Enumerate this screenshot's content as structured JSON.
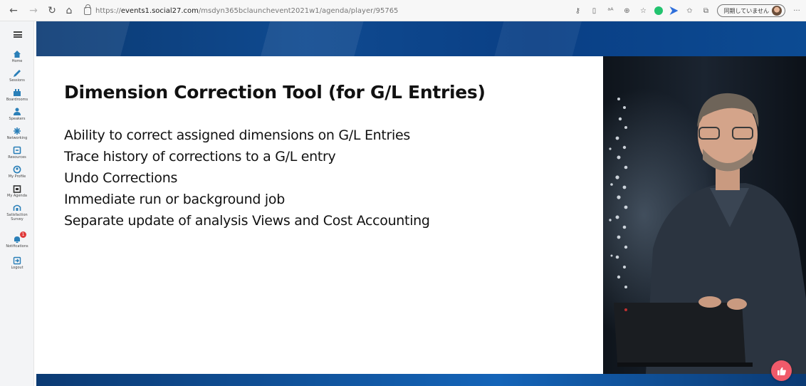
{
  "browser": {
    "url_prefix": "https://",
    "url_host": "events1.social27.com",
    "url_path": "/msdyn365bclaunchevent2021w1/agenda/player/95765",
    "sync_label": "同期していません"
  },
  "sidebar": {
    "items": [
      {
        "label": "Home",
        "icon": "home-icon"
      },
      {
        "label": "Sessions",
        "icon": "pencil-icon"
      },
      {
        "label": "Boardrooms",
        "icon": "boardroom-icon"
      },
      {
        "label": "Speakers",
        "icon": "speaker-icon"
      },
      {
        "label": "Networking",
        "icon": "networking-icon"
      },
      {
        "label": "Resources",
        "icon": "resources-icon"
      },
      {
        "label": "My Profile",
        "icon": "profile-icon"
      },
      {
        "label": "My Agenda",
        "icon": "agenda-icon"
      },
      {
        "label": "Satisfaction Survey",
        "icon": "survey-icon"
      },
      {
        "label": "Notifications",
        "icon": "bell-icon",
        "badge": "1"
      },
      {
        "label": "Logout",
        "icon": "logout-icon"
      }
    ]
  },
  "slide": {
    "title": "Dimension Correction Tool (for G/L Entries)",
    "bullets": [
      "Ability to correct assigned dimensions on G/L Entries",
      "Trace history of corrections to a G/L entry",
      "Undo Corrections",
      "Immediate run or background job",
      "Separate update of analysis Views and Cost Accounting"
    ]
  },
  "colors": {
    "accent": "#2a7fb8",
    "banner": "#0f4a90",
    "reaction": "#f05a6a"
  }
}
